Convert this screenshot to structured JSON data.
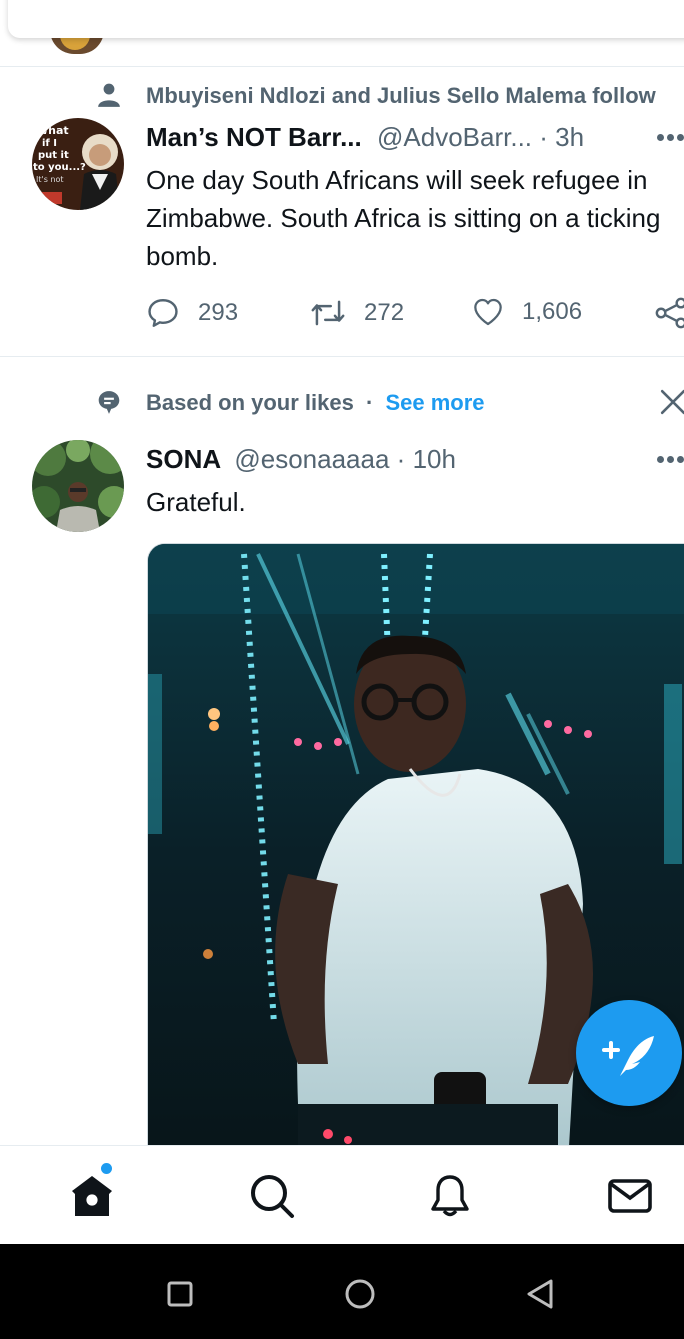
{
  "tweet1": {
    "social_context": "Mbuyiseni Ndlozi and Julius Sello Malema follow",
    "name": "Man’s NOT Barr...",
    "handle": "@AdvoBarr...",
    "separator": "·",
    "time": "3h",
    "text": "One day South Africans will seek refugee in Zimbabwe. South Africa is sitting on a ticking bomb.",
    "avatar_text": [
      "What",
      "if I",
      "put it",
      "to you...?",
      "It's not"
    ],
    "replies": "293",
    "retweets": "272",
    "likes": "1,606"
  },
  "tweet2": {
    "social_context": "Based on your likes",
    "context_separator": "·",
    "see_more": "See more",
    "name": "SONA",
    "handle": "@esonaaaaa",
    "separator": "·",
    "time": "10h",
    "text": "Grateful."
  },
  "colors": {
    "accent": "#1d9bf0",
    "secondary_text": "#536471",
    "primary_text": "#0f1419",
    "divider": "#e6ecf0"
  },
  "icons": {
    "context1": "person-icon",
    "context2": "topic-bubble-icon",
    "reply": "reply-icon",
    "retweet": "retweet-icon",
    "like": "heart-icon",
    "share": "share-icon",
    "compose": "compose-feather-icon",
    "nav": [
      "home-icon",
      "search-icon",
      "bell-icon",
      "mail-icon"
    ],
    "system": [
      "recent-apps-icon",
      "home-circle-icon",
      "back-icon"
    ]
  }
}
